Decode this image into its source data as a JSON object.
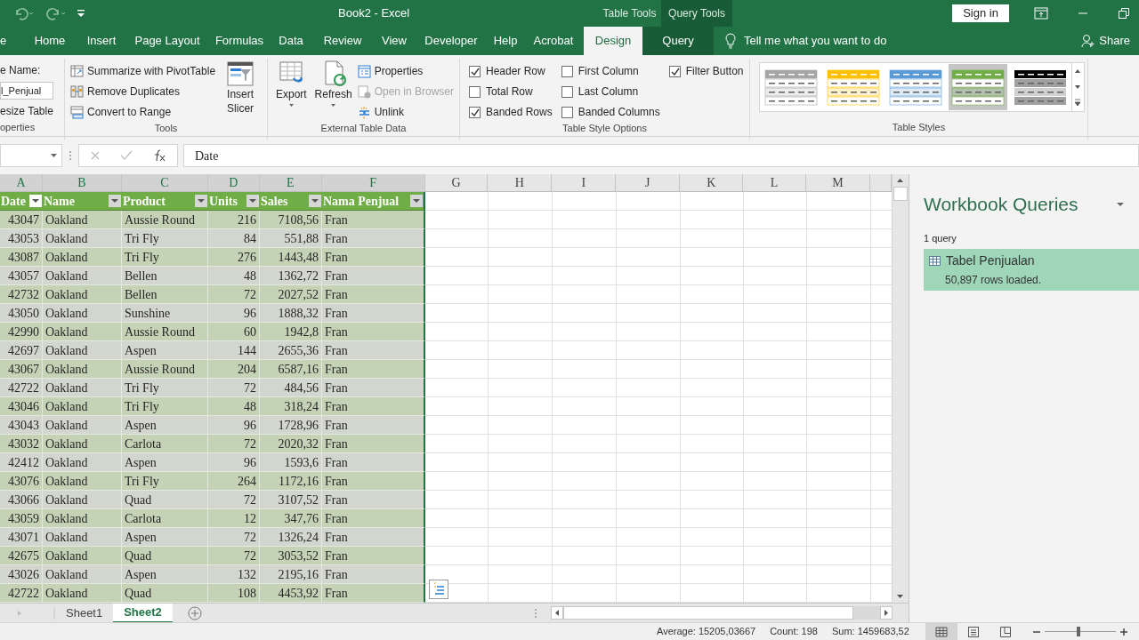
{
  "title_bar": {
    "title": "Book2  -  Excel",
    "contextual_groups": [
      {
        "label": "Table Tools",
        "kind": "table"
      },
      {
        "label": "Query Tools",
        "kind": "query"
      }
    ],
    "sign_in": "Sign in"
  },
  "tabs": [
    {
      "label": "e",
      "kind": "standard",
      "selected": false
    },
    {
      "label": "Home",
      "kind": "standard",
      "selected": false
    },
    {
      "label": "Insert",
      "kind": "standard",
      "selected": false
    },
    {
      "label": "Page Layout",
      "kind": "standard",
      "selected": false
    },
    {
      "label": "Formulas",
      "kind": "standard",
      "selected": false
    },
    {
      "label": "Data",
      "kind": "standard",
      "selected": false
    },
    {
      "label": "Review",
      "kind": "standard",
      "selected": false
    },
    {
      "label": "View",
      "kind": "standard",
      "selected": false
    },
    {
      "label": "Developer",
      "kind": "standard",
      "selected": false
    },
    {
      "label": "Help",
      "kind": "standard",
      "selected": false
    },
    {
      "label": "Acrobat",
      "kind": "standard",
      "selected": false
    },
    {
      "label": "Design",
      "kind": "table",
      "selected": true
    },
    {
      "label": "Query",
      "kind": "query",
      "selected": false
    }
  ],
  "tell_me": "Tell me what you want to do",
  "share": "Share",
  "ribbon": {
    "properties": {
      "name_label": "e Name:",
      "name_value": "l_Penjual",
      "resize": "esize Table",
      "caption": "operties"
    },
    "tools": {
      "commands": [
        {
          "label": "Summarize with PivotTable",
          "kind": "pivot"
        },
        {
          "label": "Remove Duplicates",
          "kind": "duplicates"
        },
        {
          "label": "Convert to Range",
          "kind": "convert"
        }
      ],
      "slicer": "Insert Slicer",
      "caption": "Tools"
    },
    "external": {
      "big": [
        {
          "label": "Export",
          "kind": "export"
        },
        {
          "label": "Refresh",
          "kind": "refresh"
        }
      ],
      "commands": [
        {
          "label": "Properties",
          "kind": "properties",
          "disabled": false
        },
        {
          "label": "Open in Browser",
          "kind": "browser",
          "disabled": true
        },
        {
          "label": "Unlink",
          "kind": "unlink",
          "disabled": false
        }
      ],
      "caption": "External Table Data"
    },
    "style_options": {
      "options": [
        {
          "label": "Header Row",
          "checked": true
        },
        {
          "label": "Total Row",
          "checked": false
        },
        {
          "label": "Banded Rows",
          "checked": true
        },
        {
          "label": "First Column",
          "checked": false
        },
        {
          "label": "Last Column",
          "checked": false
        },
        {
          "label": "Banded Columns",
          "checked": false
        },
        {
          "label": "Filter Button",
          "checked": true
        }
      ],
      "caption": "Table Style Options"
    },
    "table_styles": {
      "styles": [
        {
          "color": "#a5a5a5",
          "selected": false
        },
        {
          "color": "#ffc000",
          "selected": false
        },
        {
          "color": "#5b9bd5",
          "selected": false
        },
        {
          "color": "#70ad47",
          "selected": true
        },
        {
          "color": "#000000",
          "selected": false
        }
      ],
      "caption": "Table Styles"
    }
  },
  "formula_bar": {
    "formula": "Date"
  },
  "sheet": {
    "column_letters": [
      "A",
      "B",
      "C",
      "D",
      "E",
      "F",
      "G",
      "H",
      "I",
      "J",
      "K",
      "L",
      "M"
    ],
    "table": {
      "columns": [
        {
          "header": "Date",
          "kind": "number"
        },
        {
          "header": "Name",
          "kind": "text"
        },
        {
          "header": "Product",
          "kind": "text"
        },
        {
          "header": "Units",
          "kind": "number"
        },
        {
          "header": "Sales",
          "kind": "number"
        },
        {
          "header": "Nama Penjual",
          "kind": "text"
        }
      ],
      "rows": [
        [
          "43047",
          "Oakland",
          "Aussie Round",
          "216",
          "7108,56",
          "Fran"
        ],
        [
          "43053",
          "Oakland",
          "Tri Fly",
          "84",
          "551,88",
          "Fran"
        ],
        [
          "43087",
          "Oakland",
          "Tri Fly",
          "276",
          "1443,48",
          "Fran"
        ],
        [
          "43057",
          "Oakland",
          "Bellen",
          "48",
          "1362,72",
          "Fran"
        ],
        [
          "42732",
          "Oakland",
          "Bellen",
          "72",
          "2027,52",
          "Fran"
        ],
        [
          "43050",
          "Oakland",
          "Sunshine",
          "96",
          "1888,32",
          "Fran"
        ],
        [
          "42990",
          "Oakland",
          "Aussie Round",
          "60",
          "1942,8",
          "Fran"
        ],
        [
          "42697",
          "Oakland",
          "Aspen",
          "144",
          "2655,36",
          "Fran"
        ],
        [
          "43067",
          "Oakland",
          "Aussie Round",
          "204",
          "6587,16",
          "Fran"
        ],
        [
          "42722",
          "Oakland",
          "Tri Fly",
          "72",
          "484,56",
          "Fran"
        ],
        [
          "43046",
          "Oakland",
          "Tri Fly",
          "48",
          "318,24",
          "Fran"
        ],
        [
          "43043",
          "Oakland",
          "Aspen",
          "96",
          "1728,96",
          "Fran"
        ],
        [
          "43032",
          "Oakland",
          "Carlota",
          "72",
          "2020,32",
          "Fran"
        ],
        [
          "42412",
          "Oakland",
          "Aspen",
          "96",
          "1593,6",
          "Fran"
        ],
        [
          "43076",
          "Oakland",
          "Tri Fly",
          "264",
          "1172,16",
          "Fran"
        ],
        [
          "43066",
          "Oakland",
          "Quad",
          "72",
          "3107,52",
          "Fran"
        ],
        [
          "43059",
          "Oakland",
          "Carlota",
          "12",
          "347,76",
          "Fran"
        ],
        [
          "43071",
          "Oakland",
          "Aspen",
          "72",
          "1326,24",
          "Fran"
        ],
        [
          "42675",
          "Oakland",
          "Quad",
          "72",
          "3053,52",
          "Fran"
        ],
        [
          "43026",
          "Oakland",
          "Aspen",
          "132",
          "2195,16",
          "Fran"
        ],
        [
          "42722",
          "Oakland",
          "Quad",
          "108",
          "4453,92",
          "Fran"
        ]
      ]
    }
  },
  "sheet_tabs": [
    {
      "label": "Sheet1",
      "selected": false
    },
    {
      "label": "Sheet2",
      "selected": true
    }
  ],
  "queries_pane": {
    "title": "Workbook Queries",
    "count": "1 query",
    "queries": [
      {
        "name": "Tabel Penjualan",
        "detail": "50,897 rows loaded.",
        "selected": true
      }
    ]
  },
  "status_bar": {
    "average": "Average: 15205,03667",
    "count": "Count: 198",
    "sum": "Sum: 1459683,52",
    "views": [
      {
        "kind": "normal",
        "selected": true
      },
      {
        "kind": "page_layout",
        "selected": false
      },
      {
        "kind": "page_break",
        "selected": false
      }
    ],
    "zoom": {
      "level": 0.45
    }
  }
}
